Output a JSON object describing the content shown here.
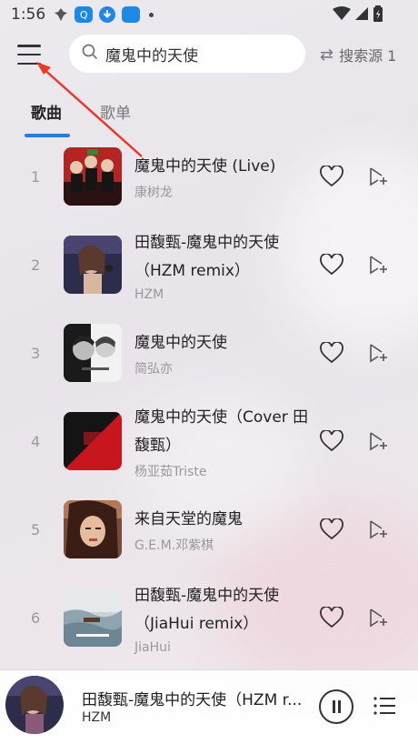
{
  "status_bar": {
    "time": "1:56",
    "app_badge_label": "Q"
  },
  "header": {
    "search": {
      "value": "魔鬼中的天使"
    },
    "source_label": "搜索源 1"
  },
  "tabs": [
    {
      "label": "歌曲",
      "active": true
    },
    {
      "label": "歌单",
      "active": false
    }
  ],
  "songs": [
    {
      "index": "1",
      "title": "魔鬼中的天使 (Live)",
      "artist": "康树龙",
      "cover_color": "#b32524"
    },
    {
      "index": "2",
      "title": "田馥甄-魔鬼中的天使（HZM remix）",
      "artist": "HZM",
      "cover_color": "#2b2d4a"
    },
    {
      "index": "3",
      "title": "魔鬼中的天使",
      "artist": "简弘亦",
      "cover_color": "#f2f2f2"
    },
    {
      "index": "4",
      "title": "魔鬼中的天使（Cover 田馥甄）",
      "artist": "杨亚茹Triste",
      "cover_color": "#c8161e"
    },
    {
      "index": "5",
      "title": "来自天堂的魔鬼",
      "artist": "G.E.M.邓紫棋",
      "cover_color": "#7a4a3a"
    },
    {
      "index": "6",
      "title": "田馥甄-魔鬼中的天使（JiaHui remix）",
      "artist": "JiaHui",
      "cover_color": "#8fa4b0"
    }
  ],
  "player": {
    "title": "田馥甄-魔鬼中的天使（HZM r...",
    "artist": "HZM"
  },
  "colors": {
    "accent": "#2b7bd8",
    "annotation_arrow": "#e8392b"
  }
}
